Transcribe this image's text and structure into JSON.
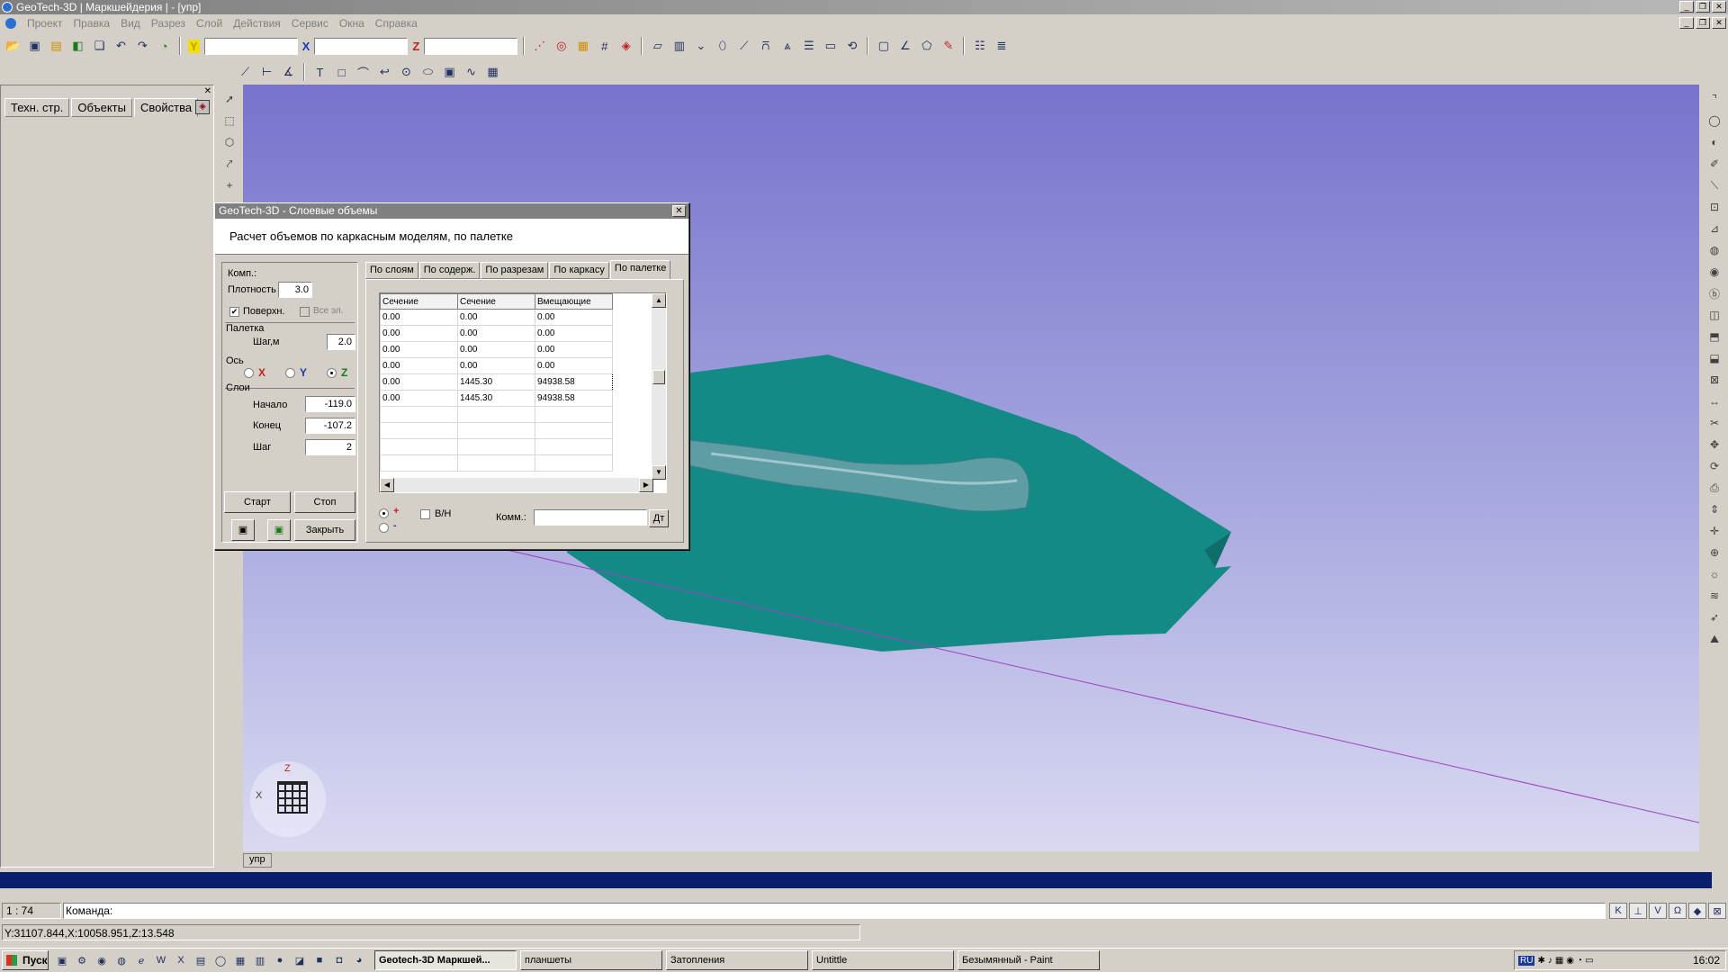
{
  "window": {
    "title": "GeoTech-3D | Маркшейдерия | - [упр]"
  },
  "menu": [
    "Проект",
    "Правка",
    "Вид",
    "Разрез",
    "Слой",
    "Действия",
    "Сервис",
    "Окна",
    "Справка"
  ],
  "toolbar": {
    "y_label": "Y",
    "x_label": "X",
    "z_label": "Z",
    "y_value": "",
    "x_value": "",
    "z_value": ""
  },
  "left_panel": {
    "tabs": [
      "Техн. стр.",
      "Объекты",
      "Свойства"
    ],
    "active_tab": "Свойства"
  },
  "dialog": {
    "title": "GeoTech-3D - Слоевые объемы",
    "header": "Расчет объемов по каркасным моделям, по палетке",
    "komp_label": "Комп.:",
    "density_label": "Плотность",
    "density_value": "3.0",
    "surface_label": "Поверхн.",
    "all_label": "Все эл.",
    "palette_label": "Палетка",
    "step_m_label": "Шаг,м",
    "step_m_value": "2.0",
    "axis_label": "Ось",
    "axis_x": "X",
    "axis_y": "Y",
    "axis_z": "Z",
    "layers_label": "Слои",
    "start_label": "Начало",
    "start_value": "-119.0",
    "end_label": "Конец",
    "end_value": "-107.2",
    "step_label": "Шаг",
    "step_value": "2",
    "btn_start": "Старт",
    "btn_stop": "Стоп",
    "btn_close": "Закрыть",
    "tabs": [
      "По слоям",
      "По содерж.",
      "По разрезам",
      "По каркасу",
      "По палетке"
    ],
    "active_tab": "По палетке",
    "columns": [
      "Сечение",
      "Сечение",
      "Вмещающие"
    ],
    "rows": [
      [
        "0.00",
        "0.00",
        "0.00"
      ],
      [
        "0.00",
        "0.00",
        "0.00"
      ],
      [
        "0.00",
        "0.00",
        "0.00"
      ],
      [
        "0.00",
        "0.00",
        "0.00"
      ],
      [
        "0.00",
        "1445.30",
        "94938.58"
      ],
      [
        "0.00",
        "1445.30",
        "94938.58"
      ]
    ],
    "plus": "+",
    "minus": "-",
    "vn_label": "В/Н",
    "komm_label": "Комм.:",
    "komm_value": "",
    "dt_btn": "Дт"
  },
  "viewport": {
    "tab": "упр",
    "axis_x": "X",
    "axis_z": "Z",
    "colors": {
      "sky_top": "#7674cc",
      "sky_bottom": "#d9d9f2",
      "body": "#138a85",
      "ore": "#5f9da4",
      "line": "#a040c0"
    }
  },
  "command": {
    "scale": "1 : 74",
    "prompt": "Команда:",
    "icons": [
      "K",
      "⊥",
      "V",
      "Ω",
      "◆",
      "⊠"
    ]
  },
  "status": {
    "coords": "Y:31107.844,X:10058.951,Z:13.548"
  },
  "taskbar": {
    "start": "Пуск",
    "tasks": [
      "Geotech-3D Маркшей...",
      "планшеты",
      "Затопления",
      "Untittle",
      "Безымянный - Paint"
    ],
    "lang": "RU",
    "clock": "16:02"
  }
}
